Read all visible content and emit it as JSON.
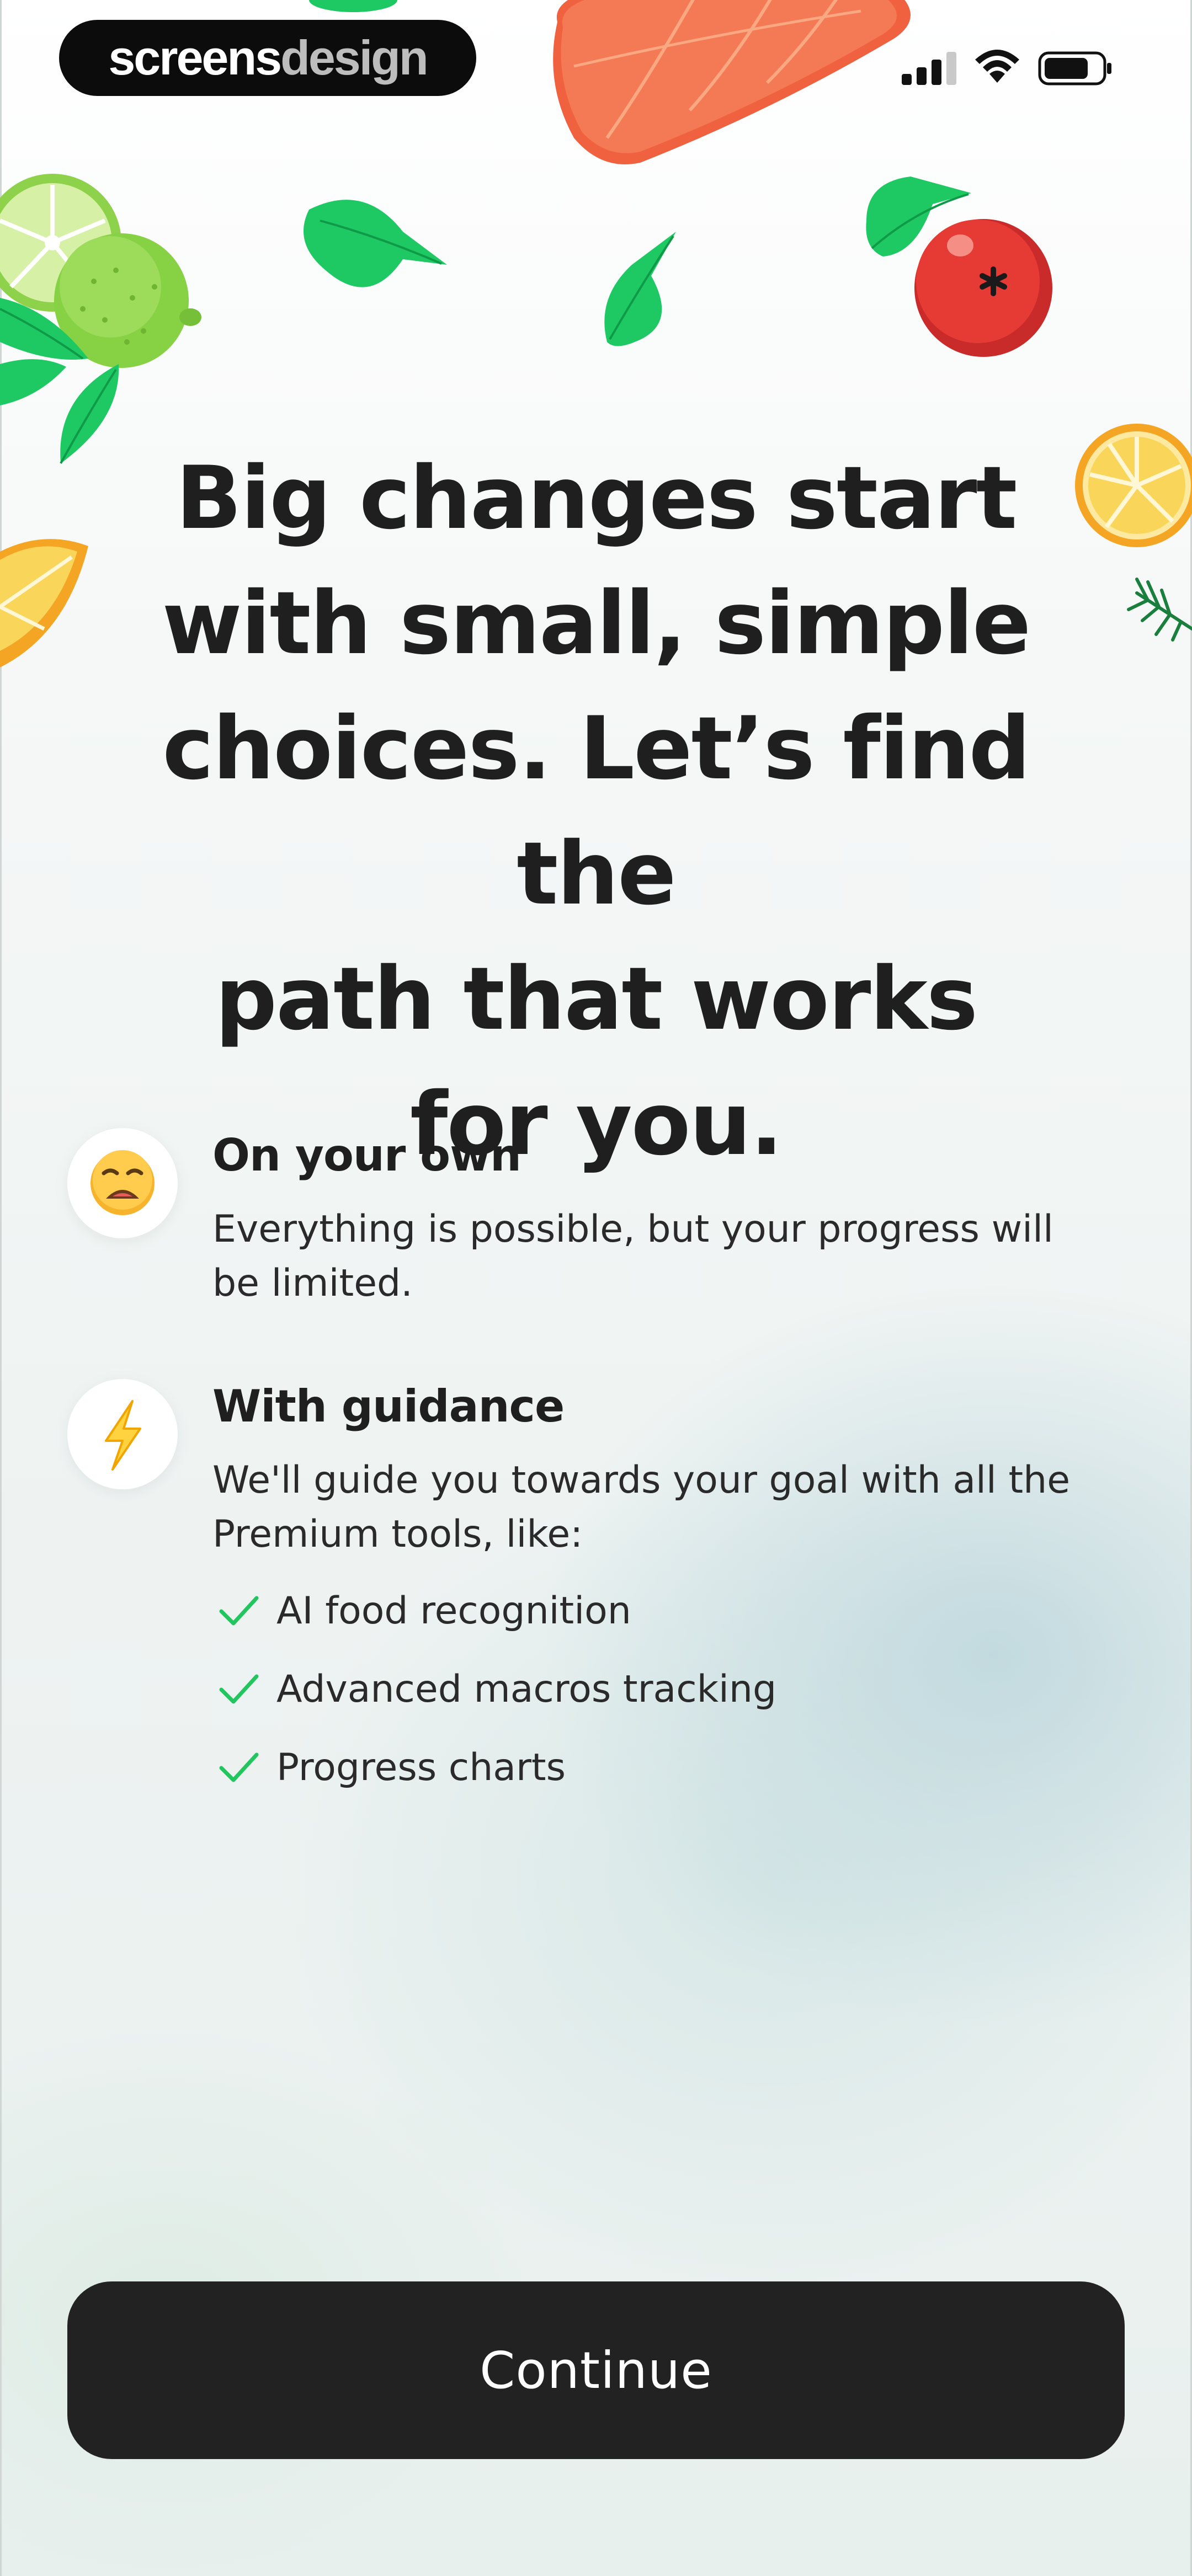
{
  "brand": {
    "part1": "screens",
    "part2": "design"
  },
  "status_bar": {
    "icons": [
      "signal-icon",
      "wifi-icon",
      "battery-icon"
    ]
  },
  "decorations": [
    "salmon-illustration",
    "lime-illustration",
    "lemon-slice-illustration",
    "tomato-illustration",
    "basil-leaf-illustration",
    "rosemary-illustration"
  ],
  "headline": {
    "lines": [
      "Big changes start",
      "with small, simple",
      "choices. Let’s find the",
      "path that works",
      "for you."
    ]
  },
  "options": [
    {
      "icon": "weary-face-icon",
      "title": "On your own",
      "description_lines": [
        "Everything is possible, but your progress will",
        "be limited."
      ]
    },
    {
      "icon": "lightning-icon",
      "title": "With guidance",
      "description_lines": [
        "We'll guide you towards your goal with all the",
        "Premium tools, like:"
      ],
      "features": [
        "AI food recognition",
        "Advanced macros tracking",
        "Progress charts"
      ]
    }
  ],
  "continue_label": "Continue",
  "colors": {
    "accent_green": "#22c55e",
    "button": "#222222",
    "text": "#1f1f1f"
  }
}
